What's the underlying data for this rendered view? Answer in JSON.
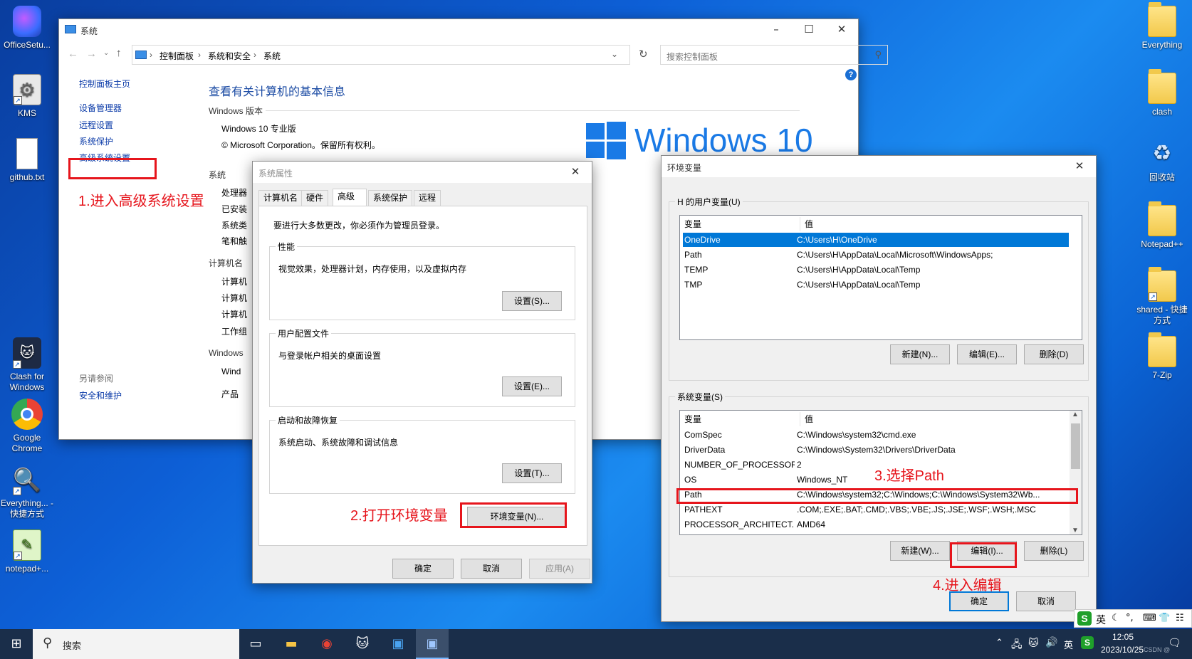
{
  "desktop": {
    "icons_left": [
      "OfficeSetu...",
      "KMS",
      "github.txt",
      "Clash for Windows",
      "Google Chrome",
      "Everything... - 快捷方式",
      "notepad+..."
    ],
    "icons_right": [
      "Everything",
      "clash",
      "回收站",
      "Notepad++",
      "shared - 快捷方式",
      "7-Zip"
    ]
  },
  "system_window": {
    "title": "系统",
    "breadcrumb": [
      "控制面板",
      "系统和安全",
      "系统"
    ],
    "search_placeholder": "搜索控制面板",
    "sidebar": {
      "home": "控制面板主页",
      "items": [
        "设备管理器",
        "远程设置",
        "系统保护",
        "高级系统设置"
      ],
      "see_also_header": "另请参阅",
      "see_also": "安全和维护"
    },
    "heading": "查看有关计算机的基本信息",
    "windows_edition_header": "Windows 版本",
    "edition": "Windows 10 专业版",
    "copyright": "© Microsoft Corporation。保留所有权利。",
    "logo_text": "Windows 10",
    "system_header": "系统",
    "system_rows": [
      "处理器",
      "已安装",
      "系统类",
      "笔和触"
    ],
    "computer_header": "计算机名",
    "computer_rows": [
      "计算机",
      "计算机",
      "计算机",
      "工作组"
    ],
    "activation_header": "Windows",
    "activation_rows": [
      "Wind",
      "产品"
    ]
  },
  "system_properties": {
    "title": "系统属性",
    "tabs": [
      "计算机名",
      "硬件",
      "高级",
      "系统保护",
      "远程"
    ],
    "admin_note": "要进行大多数更改，你必须作为管理员登录。",
    "performance": {
      "title": "性能",
      "desc": "视觉效果，处理器计划，内存使用，以及虚拟内存",
      "button": "设置(S)..."
    },
    "profiles": {
      "title": "用户配置文件",
      "desc": "与登录帐户相关的桌面设置",
      "button": "设置(E)..."
    },
    "startup": {
      "title": "启动和故障恢复",
      "desc": "系统启动、系统故障和调试信息",
      "button": "设置(T)..."
    },
    "env_button": "环境变量(N)...",
    "ok": "确定",
    "cancel": "取消",
    "apply": "应用(A)"
  },
  "env_vars": {
    "title": "环境变量",
    "user_group": "H 的用户变量(U)",
    "col_var": "变量",
    "col_val": "值",
    "user_rows": [
      {
        "name": "OneDrive",
        "value": "C:\\Users\\H\\OneDrive"
      },
      {
        "name": "Path",
        "value": "C:\\Users\\H\\AppData\\Local\\Microsoft\\WindowsApps;"
      },
      {
        "name": "TEMP",
        "value": "C:\\Users\\H\\AppData\\Local\\Temp"
      },
      {
        "name": "TMP",
        "value": "C:\\Users\\H\\AppData\\Local\\Temp"
      }
    ],
    "user_buttons": [
      "新建(N)...",
      "编辑(E)...",
      "删除(D)"
    ],
    "system_group": "系统变量(S)",
    "system_rows": [
      {
        "name": "ComSpec",
        "value": "C:\\Windows\\system32\\cmd.exe"
      },
      {
        "name": "DriverData",
        "value": "C:\\Windows\\System32\\Drivers\\DriverData"
      },
      {
        "name": "NUMBER_OF_PROCESSORS",
        "value": "2"
      },
      {
        "name": "OS",
        "value": "Windows_NT"
      },
      {
        "name": "Path",
        "value": "C:\\Windows\\system32;C:\\Windows;C:\\Windows\\System32\\Wb..."
      },
      {
        "name": "PATHEXT",
        "value": ".COM;.EXE;.BAT;.CMD;.VBS;.VBE;.JS;.JSE;.WSF;.WSH;.MSC"
      },
      {
        "name": "PROCESSOR_ARCHITECT...",
        "value": "AMD64"
      }
    ],
    "system_buttons": [
      "新建(W)...",
      "编辑(I)...",
      "删除(L)"
    ],
    "ok": "确定",
    "cancel": "取消"
  },
  "annotations": {
    "step1": "1.进入高级系统设置",
    "step2": "2.打开环境变量",
    "step3": "3.选择Path",
    "step4": "4.进入编辑",
    "accent_color": "#e6151c"
  },
  "taskbar": {
    "search_label": "搜索",
    "ime": "英",
    "ime_tray": "英",
    "time": "12:05",
    "date": "2023/10/25",
    "watermark": "CSDN @"
  }
}
